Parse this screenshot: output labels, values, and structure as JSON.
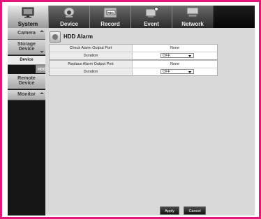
{
  "tabs": [
    {
      "label": "System",
      "icon": "monitor-icon"
    },
    {
      "label": "Device",
      "icon": "camera-icon"
    },
    {
      "label": "Record",
      "icon": "rec-icon"
    },
    {
      "label": "Event",
      "icon": "event-icon"
    },
    {
      "label": "Network",
      "icon": "network-icon"
    }
  ],
  "sidebar": {
    "camera": {
      "label": "Camera"
    },
    "storage": {
      "label_line1": "Storage",
      "label_line2": "Device"
    },
    "sub_device": {
      "label": "Device"
    },
    "sub_hdd_alarm": {
      "label": "HDD Alarm"
    },
    "remote": {
      "label_line1": "Remote",
      "label_line2": "Device"
    },
    "monitor": {
      "label": "Monitor"
    }
  },
  "main": {
    "title": "HDD Alarm",
    "check_port_label": "Check Alarm Output Port",
    "check_port_value": "None",
    "check_duration_label": "Duration",
    "check_duration_value": "OFF",
    "replace_port_label": "Replace Alarm Output Port",
    "replace_port_value": "None",
    "replace_duration_label": "Duration",
    "replace_duration_value": "OFF",
    "apply_label": "Apply",
    "cancel_label": "Cancel"
  },
  "colors": {
    "border": "#e5177a",
    "active_tab": "#d0d0d0"
  }
}
